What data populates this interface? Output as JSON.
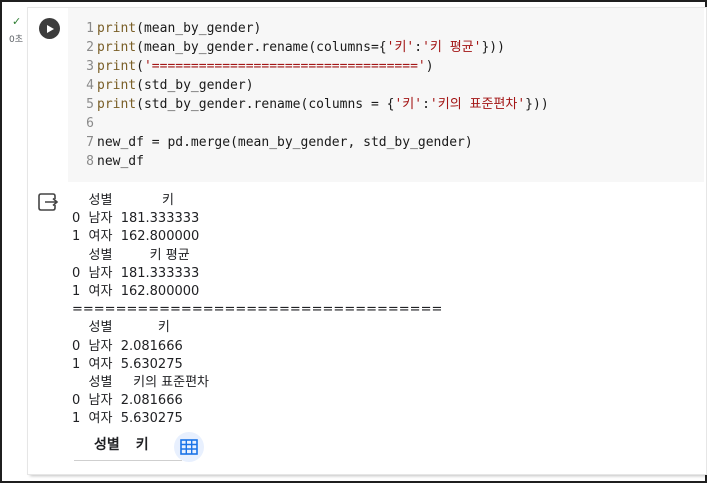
{
  "cell": {
    "status": "✓",
    "execution_time": "0초",
    "code_lines": [
      {
        "num": "1",
        "tokens": [
          [
            "fn",
            "print"
          ],
          [
            "op",
            "("
          ],
          [
            "id",
            "mean_by_gender"
          ],
          [
            "op",
            ")"
          ]
        ]
      },
      {
        "num": "2",
        "tokens": [
          [
            "fn",
            "print"
          ],
          [
            "op",
            "("
          ],
          [
            "id",
            "mean_by_gender.rename"
          ],
          [
            "op",
            "("
          ],
          [
            "id",
            "columns="
          ],
          [
            "op",
            "{"
          ],
          [
            "str",
            "'키'"
          ],
          [
            "op",
            ":"
          ],
          [
            "str",
            "'키 평균'"
          ],
          [
            "op",
            "})"
          ],
          [
            "op",
            ")"
          ]
        ]
      },
      {
        "num": "3",
        "tokens": [
          [
            "fn",
            "print"
          ],
          [
            "op",
            "("
          ],
          [
            "str",
            "'=================================='"
          ],
          [
            "op",
            ")"
          ]
        ]
      },
      {
        "num": "4",
        "tokens": [
          [
            "fn",
            "print"
          ],
          [
            "op",
            "("
          ],
          [
            "id",
            "std_by_gender"
          ],
          [
            "op",
            ")"
          ]
        ]
      },
      {
        "num": "5",
        "tokens": [
          [
            "fn",
            "print"
          ],
          [
            "op",
            "("
          ],
          [
            "id",
            "std_by_gender.rename"
          ],
          [
            "op",
            "("
          ],
          [
            "id",
            "columns = "
          ],
          [
            "op",
            "{"
          ],
          [
            "str",
            "'키'"
          ],
          [
            "op",
            ":"
          ],
          [
            "str",
            "'키의 표준편차'"
          ],
          [
            "op",
            "})"
          ],
          [
            "op",
            ")"
          ]
        ]
      },
      {
        "num": "6",
        "tokens": []
      },
      {
        "num": "7",
        "tokens": [
          [
            "id",
            "new_df = pd.merge"
          ],
          [
            "op",
            "("
          ],
          [
            "id",
            "mean_by_gender, std_by_gender"
          ],
          [
            "op",
            ")"
          ]
        ]
      },
      {
        "num": "8",
        "tokens": [
          [
            "id",
            "new_df"
          ]
        ]
      }
    ]
  },
  "output": {
    "text": "    성별            키\n0  남자  181.333333\n1  여자  162.800000\n    성별         키 평균\n0  남자  181.333333\n1  여자  162.800000\n==================================\n    성별           키\n0  남자  2.081666\n1  여자  5.630275\n    성별     키의 표준편차\n0  남자  2.081666\n1  여자  5.630275",
    "df_columns": [
      "성별",
      "키"
    ]
  },
  "colors": {
    "function": "#795e26",
    "string": "#a31515",
    "line_number": "#8a8a8a",
    "success": "#2e7d32"
  },
  "icons": {
    "run": "play-icon",
    "output": "output-icon",
    "table": "table-icon",
    "status": "check-icon"
  }
}
